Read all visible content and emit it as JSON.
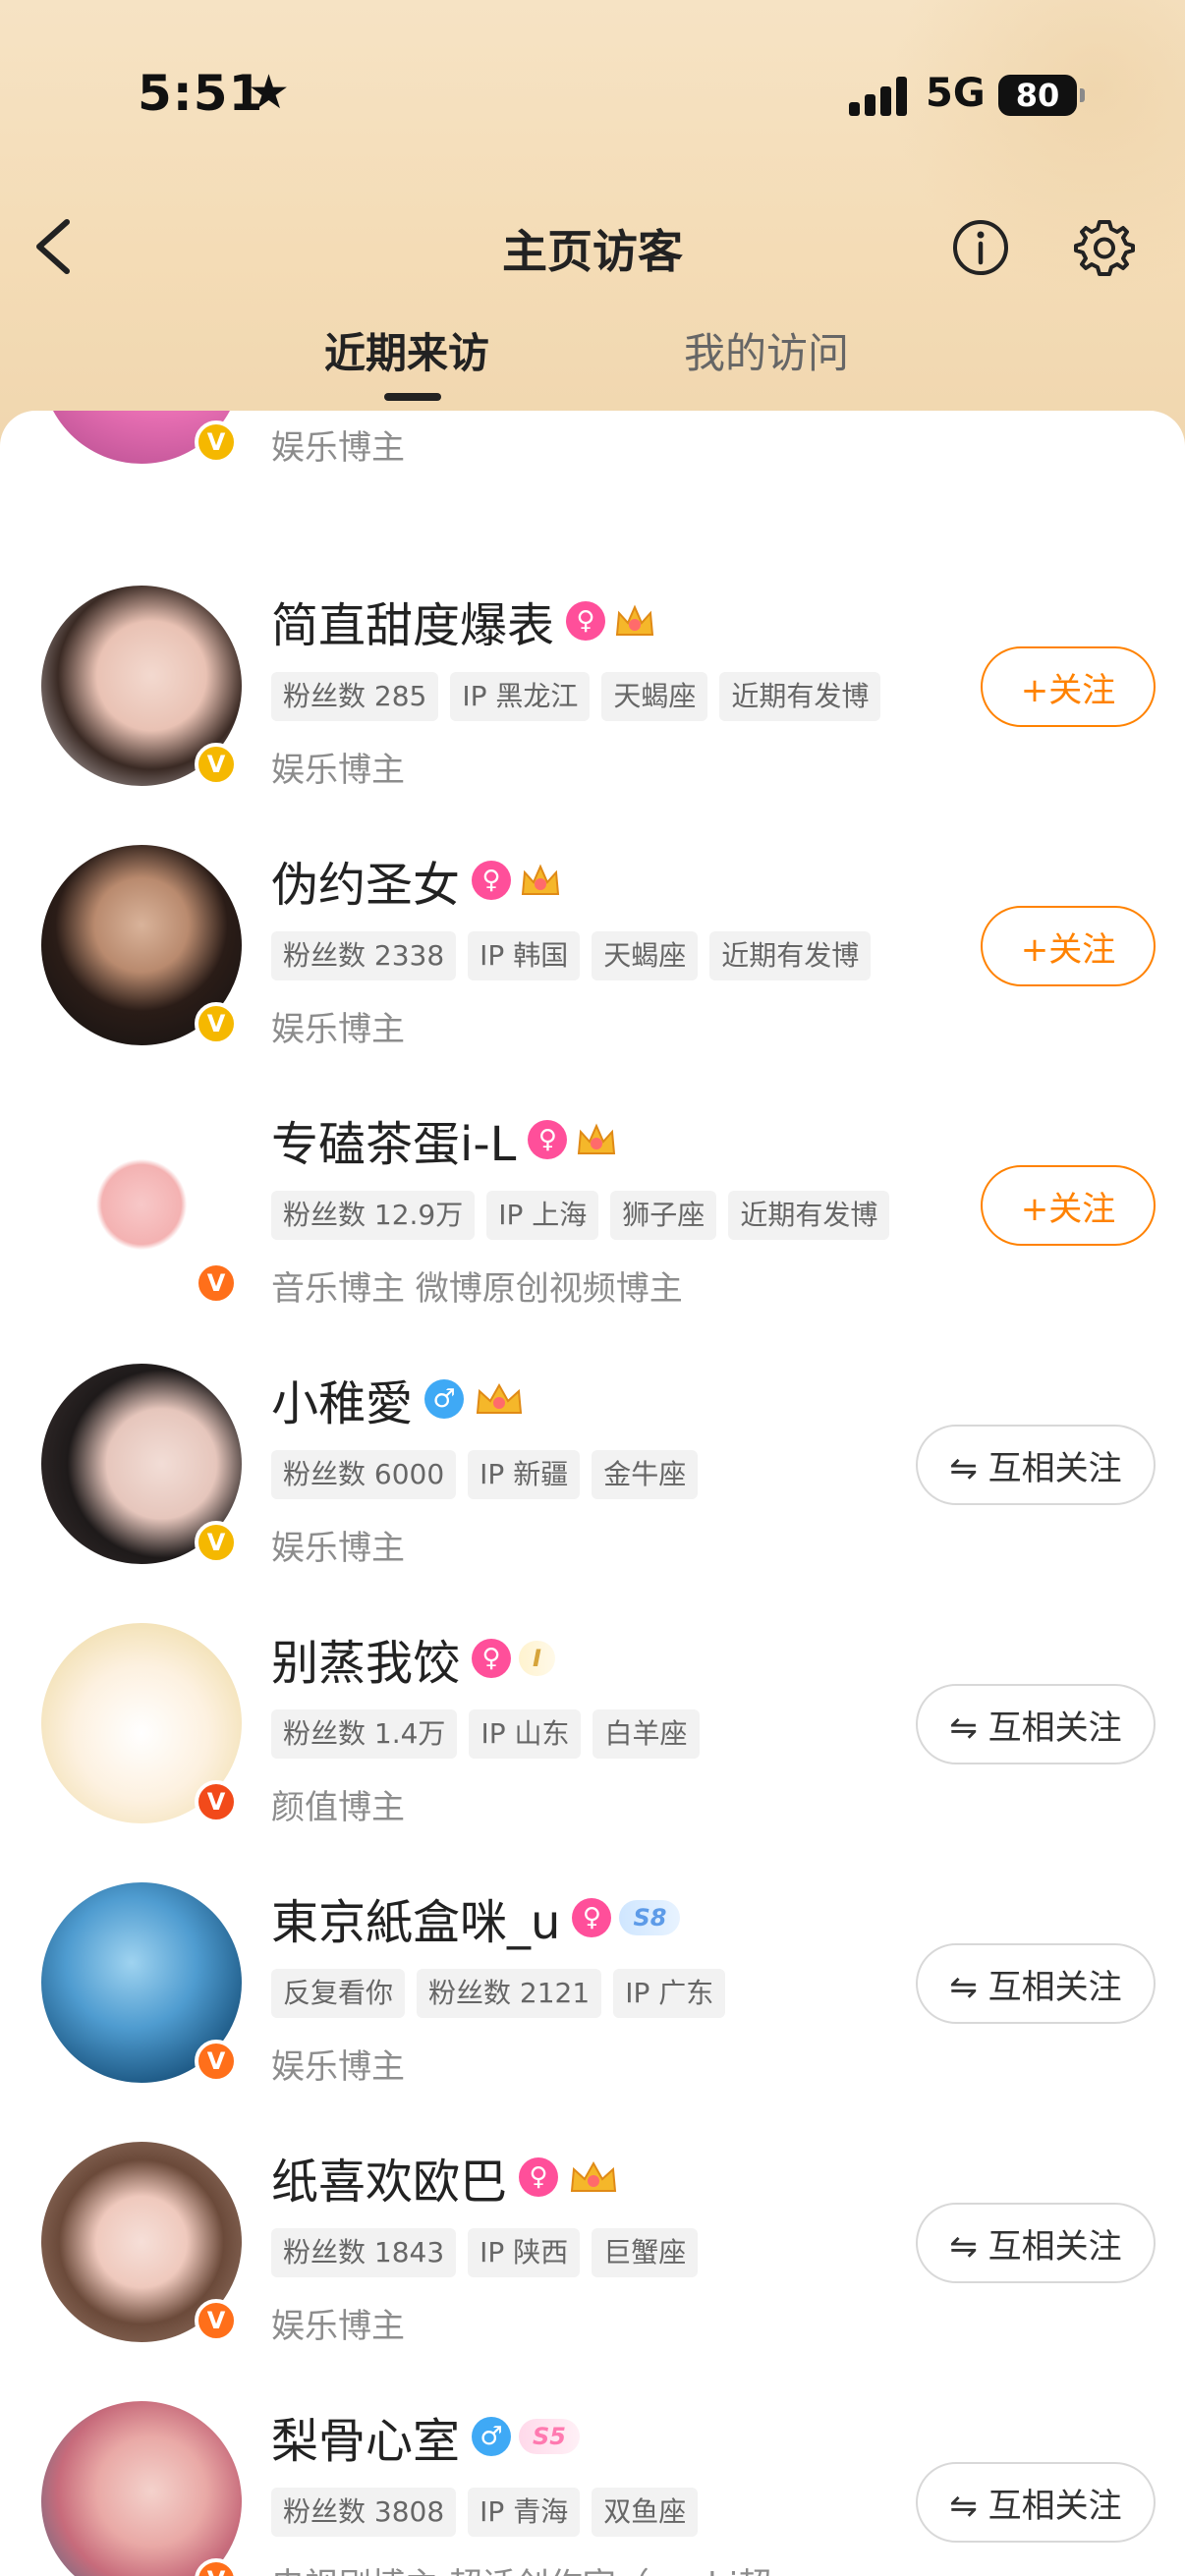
{
  "status_bar": {
    "time": "5:51",
    "network": "5G",
    "battery": "80"
  },
  "nav": {
    "title": "主页访客"
  },
  "tabs": [
    {
      "label": "近期来访",
      "active": true
    },
    {
      "label": "我的访问",
      "active": false
    }
  ],
  "partial_row": {
    "description": "娱乐博主",
    "badge": "V"
  },
  "visitors": [
    {
      "name": "简直甜度爆表",
      "gender": "♀",
      "tags": [
        "粉丝数 285",
        "IP 黑龙江",
        "天蝎座",
        "近期有发博"
      ],
      "description": "娱乐博主",
      "badge": "V",
      "button": "+关注"
    },
    {
      "name": "伪约圣女",
      "gender": "♀",
      "tags": [
        "粉丝数 2338",
        "IP 韩国",
        "天蝎座",
        "近期有发博"
      ],
      "description": "娱乐博主",
      "badge": "V",
      "button": "+关注"
    },
    {
      "name": "专磕茶蛋i-L",
      "gender": "♀",
      "tags": [
        "粉丝数 12.9万",
        "IP 上海",
        "狮子座",
        "近期有发博"
      ],
      "description": "音乐博主 微博原创视频博主",
      "badge": "V",
      "button": "+关注"
    },
    {
      "name": "小稚愛",
      "gender": "♂",
      "tags": [
        "粉丝数 6000",
        "IP 新疆",
        "金牛座"
      ],
      "description": "娱乐博主",
      "badge": "V",
      "button": "⇋ 互相关注"
    },
    {
      "name": "别蒸我饺",
      "gender": "♀",
      "tags": [
        "粉丝数 1.4万",
        "IP 山东",
        "白羊座"
      ],
      "description": "颜值博主",
      "badge": "V",
      "button": "⇋ 互相关注",
      "level": "I"
    },
    {
      "name": "東京紙盒咪_u",
      "gender": "♀",
      "tags": [
        "反复看你",
        "粉丝数 2121",
        "IP 广东"
      ],
      "description": "娱乐博主",
      "badge": "V",
      "button": "⇋ 互相关注",
      "level": "S8"
    },
    {
      "name": "纸喜欢欧巴",
      "gender": "♀",
      "tags": [
        "粉丝数 1843",
        "IP 陕西",
        "巨蟹座"
      ],
      "description": "娱乐博主",
      "badge": "V",
      "button": "⇋ 互相关注"
    },
    {
      "name": "梨骨心室",
      "gender": "♂",
      "tags": [
        "粉丝数 3808",
        "IP 青海",
        "双鱼座"
      ],
      "description": "电视剧博主 超话创作官（yushi超",
      "badge": "V",
      "button": "⇋ 互相关注",
      "level": "S5"
    }
  ],
  "colors": {
    "accent": "#ff8200",
    "header_bg": "#f4dcb6",
    "v_badge": "#f5b800"
  }
}
